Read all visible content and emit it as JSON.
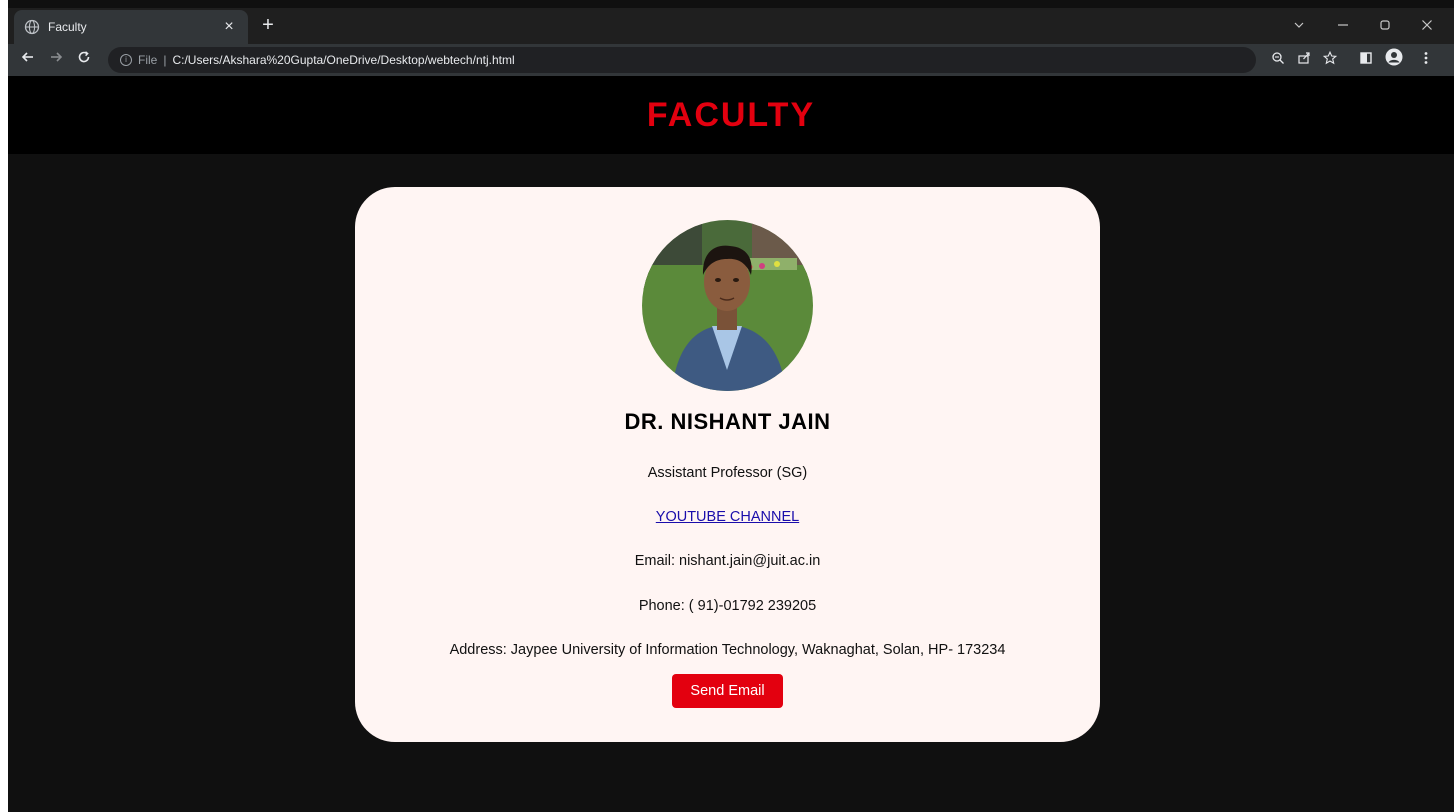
{
  "browser": {
    "tab_title": "Faculty",
    "tab_close": "×",
    "new_tab": "+",
    "file_label": "File",
    "separator": "|",
    "url": "C:/Users/Akshara%20Gupta/OneDrive/Desktop/webtech/ntj.html"
  },
  "page": {
    "title": "FACULTY"
  },
  "profile": {
    "name": "DR. NISHANT JAIN",
    "designation": "Assistant Professor (SG)",
    "youtube_label": "YOUTUBE CHANNEL",
    "email": "Email: nishant.jain@juit.ac.in",
    "phone": "Phone: ( 91)-01792 239205",
    "address": "Address: Jaypee University of Information Technology, Waknaghat, Solan, HP- 173234",
    "send_email_label": "Send Email"
  },
  "colors": {
    "accent_red": "#e3000f",
    "card_bg": "#fff5f3",
    "link": "#1a0dab"
  },
  "icons": [
    "globe-icon",
    "close-icon",
    "plus-icon",
    "chevron-down-icon",
    "minimize-icon",
    "restore-icon",
    "close-window-icon",
    "back-arrow-icon",
    "forward-arrow-icon",
    "reload-icon",
    "info-icon",
    "zoom-icon",
    "share-icon",
    "star-icon",
    "side-panel-icon",
    "profile-icon",
    "menu-dots-icon"
  ]
}
